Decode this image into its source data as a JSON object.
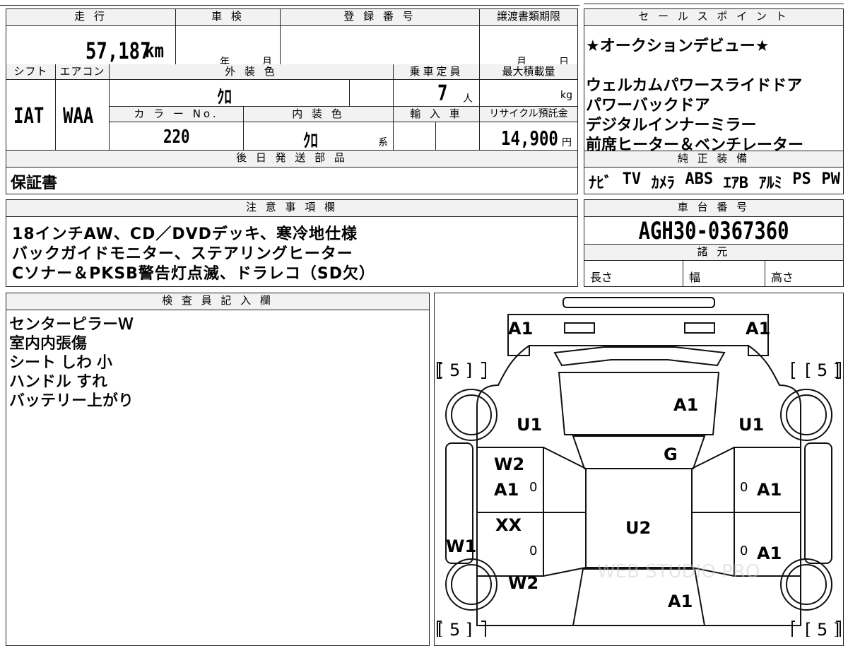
{
  "top_left": {
    "mileage_header": "走 行",
    "mileage_value": "57,187",
    "mileage_unit": "km",
    "inspection_header": "車 検",
    "inspection_year": "年",
    "inspection_month": "月",
    "registration_header": "登 録 番 号",
    "transfer_header": "譲渡書類期限",
    "transfer_month": "月",
    "transfer_day": "日"
  },
  "row2": {
    "shift_header": "シフト",
    "shift_value": "IAT",
    "aircon_header": "エアコン",
    "aircon_value": "WAA",
    "exterior_header": "外 装 色",
    "exterior_value": "ｸﾛ",
    "capacity_header": "乗車定員",
    "capacity_value": "7",
    "capacity_unit": "人",
    "load_header": "最大積載量",
    "load_unit": "kg",
    "color_no_header": "カ ラ ー No.",
    "color_no_value": "220",
    "interior_header": "内 装 色",
    "interior_value": "ｸﾛ",
    "interior_unit": "系",
    "import_header": "輸 入 車",
    "recycle_header": "リサイクル預託金",
    "recycle_value": "14,900",
    "recycle_unit": "円"
  },
  "later_parts": {
    "header": "後 日 発 送 部 品",
    "value": "保証書"
  },
  "sales_points": {
    "header": "セ ー ル ス ポ イ ン ト",
    "lines": [
      "★オークションデビュー★",
      "",
      "ウェルカムパワースライドドア",
      "パワーバックドア",
      "デジタルインナーミラー",
      "前席ヒーター＆ベンチレーター"
    ]
  },
  "genuine_equipment": {
    "header": "純 正 装 備",
    "items": [
      "ﾅﾋﾞ",
      "TV",
      "ｶﾒﾗ",
      "ABS",
      "ｴｱB",
      "ｱﾙﾐ",
      "PS",
      "PW"
    ]
  },
  "notes": {
    "header": "注 意 事 項 欄",
    "lines": [
      "18インチAW、CD／DVDデッキ、寒冷地仕様",
      "バックガイドモニター、ステアリングヒーター",
      "Cソナー＆PKSB警告灯点滅、ドラレコ（SD欠）"
    ]
  },
  "chassis": {
    "header": "車 台 番 号",
    "value": "AGH30-0367360",
    "spec_header": "諸 元",
    "length_label": "長さ",
    "width_label": "幅",
    "height_label": "高さ"
  },
  "inspector": {
    "header": "検 査 員 記 入 欄",
    "lines": [
      "センターピラーW",
      "室内内張傷",
      "シート しわ 小",
      "ハンドル すれ",
      "バッテリー上がり"
    ]
  },
  "diagram": {
    "marks": {
      "front_left": "A1",
      "front_right": "A1",
      "tire_fl": "[ 5 ]",
      "tire_fr": "[ 5 ]",
      "tire_rl": "[ 5 ]",
      "tire_rr": "[ 5 ]",
      "hood": "A1",
      "fender_left": "U1",
      "fender_right": "U1",
      "windshield": "G",
      "front_door_left_1": "W2",
      "front_door_left_2": "A1",
      "front_door_right": "A1",
      "rear_door_left": "XX",
      "rear_door_right": "A1",
      "sill_left": "W1",
      "roof": "U2",
      "rear_quarter_left": "W2",
      "rear": "A1",
      "zero_1": "0",
      "zero_2": "0",
      "zero_3": "0",
      "zero_4": "0"
    },
    "watermark": "WEB STUDIO PRO"
  }
}
